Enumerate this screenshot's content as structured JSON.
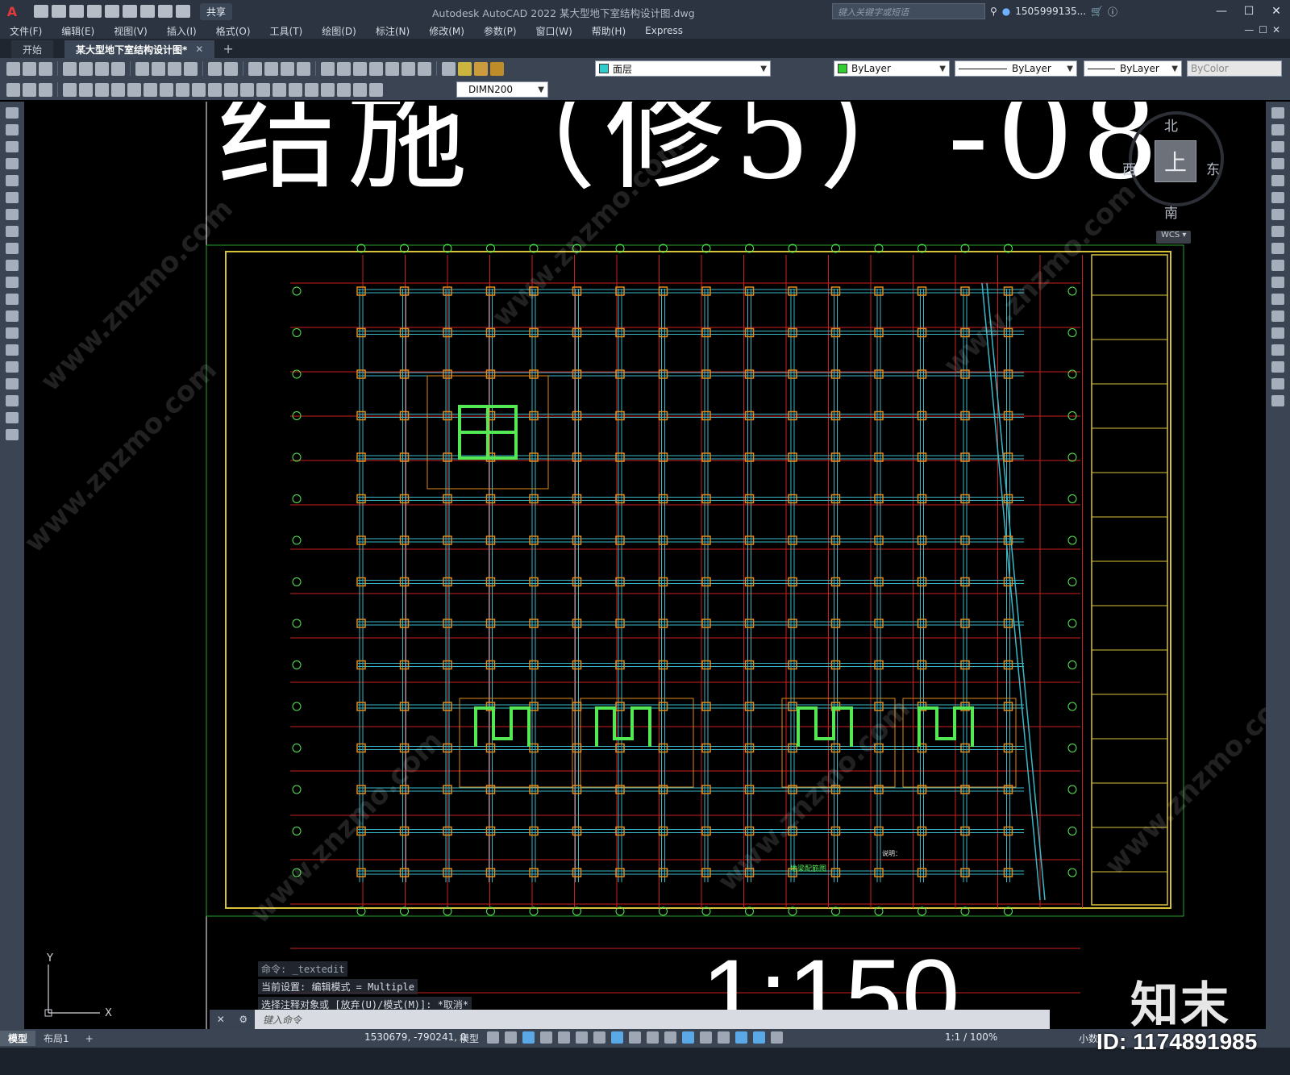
{
  "app": {
    "logo": "A",
    "title": "Autodesk AutoCAD 2022    某大型地下室结构设计图.dwg",
    "share_label": "共享",
    "search_placeholder": "键入关键字或短语",
    "user": "1505999135...",
    "window_controls": [
      "—",
      "☐",
      "✕"
    ]
  },
  "menu": [
    "文件(F)",
    "编辑(E)",
    "视图(V)",
    "插入(I)",
    "格式(O)",
    "工具(T)",
    "绘图(D)",
    "标注(N)",
    "修改(M)",
    "参数(P)",
    "窗口(W)",
    "帮助(H)",
    "Express"
  ],
  "doc_tabs": [
    {
      "label": "开始",
      "active": false
    },
    {
      "label": "某大型地下室结构设计图*",
      "active": true
    }
  ],
  "toolbar": {
    "layer_name": "面层",
    "color": "ByLayer",
    "linetype": "ByLayer",
    "lineweight": "ByLayer",
    "plotstyle": "ByColor",
    "dimstyle": "DIMN200"
  },
  "canvas": {
    "title_text": "结施（修5）-08",
    "scale_text": "1:150",
    "viewcube": {
      "north": "北",
      "south": "南",
      "east": "东",
      "west": "西",
      "top": "上"
    },
    "wcs_label": "WCS ▾",
    "ucs": {
      "x": "X",
      "y": "Y"
    },
    "drawing_notes_title": "地梁配筋图",
    "drawing_notes_header": "说明："
  },
  "command": {
    "history": [
      "命令: _textedit",
      "当前设置: 编辑模式 = Multiple",
      "选择注释对象或 [放弃(U)/模式(M)]: *取消*"
    ],
    "input_placeholder": "键入命令"
  },
  "status": {
    "layout_tabs": [
      {
        "label": "模型",
        "active": true
      },
      {
        "label": "布局1",
        "active": false
      }
    ],
    "coords": "1530679, -790241, 0",
    "space": "模型",
    "annotation_scale": "1:1 / 100%",
    "units": "小数"
  },
  "watermark": {
    "logo": "知末",
    "id": "ID: 1174891985",
    "site": "www.znzmo.com"
  },
  "colors": {
    "beam_cyan": "#39b8c8",
    "column_orange": "#e08a1a",
    "wall_green": "#55e855",
    "border_yellow": "#d8c23a",
    "axis_red": "#cc1f1f",
    "frame_green": "#2aa12a"
  }
}
